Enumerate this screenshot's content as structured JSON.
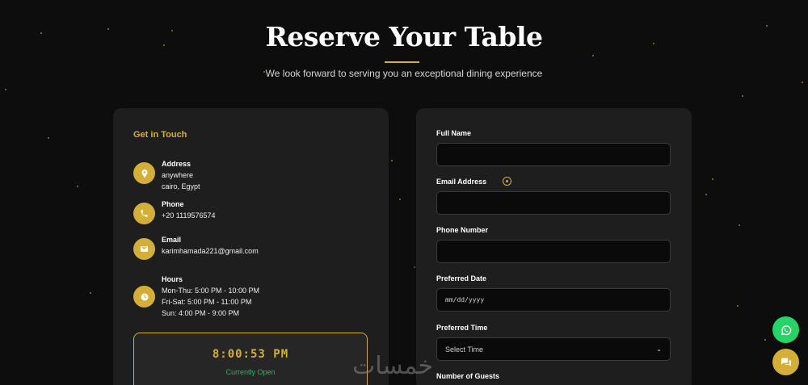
{
  "hero": {
    "title": "Reserve Your Table",
    "subtitle": "We look forward to serving you an exceptional dining experience"
  },
  "contact": {
    "title": "Get in Touch",
    "address": {
      "label": "Address",
      "lines": [
        "anywhere",
        "cairo, Egypt"
      ],
      "icon": "location-pin-icon"
    },
    "phone": {
      "label": "Phone",
      "value": "+20 1119576574",
      "icon": "phone-icon"
    },
    "email": {
      "label": "Email",
      "value": "karimhamada221@gmail.com",
      "icon": "envelope-icon"
    },
    "hours": {
      "label": "Hours",
      "lines": [
        "Mon-Thu: 5:00 PM - 10:00 PM",
        "Fri-Sat: 5:00 PM - 11:00 PM",
        "Sun: 4:00 PM - 9:00 PM"
      ],
      "icon": "clock-icon"
    },
    "clock": {
      "time": "8:00:53 PM",
      "status": "Currently Open"
    }
  },
  "form": {
    "full_name": {
      "label": "Full Name",
      "value": ""
    },
    "email": {
      "label": "Email Address",
      "value": ""
    },
    "phone": {
      "label": "Phone Number",
      "value": ""
    },
    "date": {
      "label": "Preferred Date",
      "placeholder": "mm/dd/yyyy"
    },
    "time": {
      "label": "Preferred Time",
      "selected": "Select Time"
    },
    "guests": {
      "label": "Number of Guests"
    }
  },
  "watermark": "خمسات",
  "colors": {
    "accent": "#d4af37",
    "background": "#0d0d0d",
    "card": "#1e1e1e",
    "open_status": "#2fb364",
    "whatsapp": "#25d366"
  }
}
